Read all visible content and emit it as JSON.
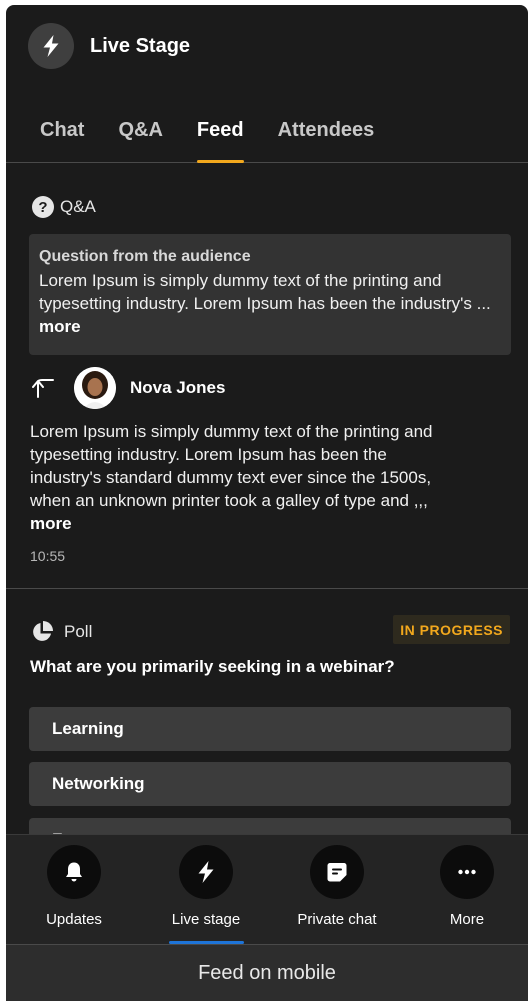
{
  "header": {
    "title": "Live Stage",
    "icon": "lightning-icon"
  },
  "tabs": [
    {
      "label": "Chat",
      "active": false
    },
    {
      "label": "Q&A",
      "active": false
    },
    {
      "label": "Feed",
      "active": true
    },
    {
      "label": "Attendees",
      "active": false
    }
  ],
  "qa": {
    "section_label": "Q&A",
    "question_heading": "Question from the audience",
    "question_text": "Lorem Ipsum is simply dummy text of the printing and typesetting industry. Lorem Ipsum has been the industry's ... ",
    "question_more": "more",
    "answer": {
      "name": "Nova Jones",
      "text": "Lorem Ipsum is simply dummy text of the printing and typesetting industry. Lorem Ipsum has been the industry's standard dummy text ever since the 1500s, when an unknown printer took a galley of type and ,,, ",
      "more": "more",
      "time": "10:55"
    }
  },
  "poll": {
    "section_label": "Poll",
    "status": "IN PROGRESS",
    "question": "What are you primarily seeking in a webinar?",
    "options": [
      "Learning",
      "Networking",
      "Fun"
    ]
  },
  "bottom_nav": [
    {
      "label": "Updates",
      "icon": "bell-icon",
      "active": false
    },
    {
      "label": "Live stage",
      "icon": "lightning-icon",
      "active": true
    },
    {
      "label": "Private chat",
      "icon": "chat-bubble-icon",
      "active": false
    },
    {
      "label": "More",
      "icon": "more-dots-icon",
      "active": false
    }
  ],
  "footer": {
    "caption": "Feed on mobile"
  },
  "colors": {
    "accent": "#f2a81d",
    "nav_indicator": "#1e74d8",
    "background": "#1b1b1b"
  }
}
